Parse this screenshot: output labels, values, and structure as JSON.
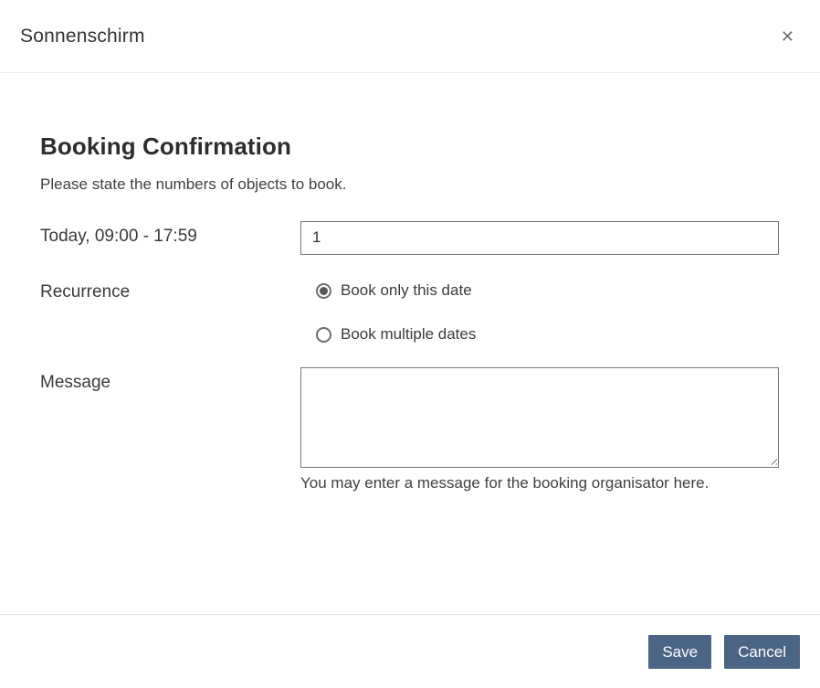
{
  "dialog": {
    "title": "Sonnenschirm",
    "close_icon": "✕"
  },
  "content": {
    "heading": "Booking Confirmation",
    "subheading": "Please state the numbers of objects to book.",
    "rows": {
      "date": {
        "label": "Today, 09:00 - 17:59",
        "quantity_value": "1"
      },
      "recurrence": {
        "label": "Recurrence",
        "options": [
          {
            "label": "Book only this date",
            "selected": true
          },
          {
            "label": "Book multiple dates",
            "selected": false
          }
        ]
      },
      "message": {
        "label": "Message",
        "value": "",
        "help": "You may enter a message for the booking organisator here."
      }
    }
  },
  "footer": {
    "save_label": "Save",
    "cancel_label": "Cancel"
  },
  "colors": {
    "button_bg": "#4b6585",
    "button_text": "#fbfdfe",
    "input_border": "#757575",
    "divider": "#e4e4e4"
  }
}
